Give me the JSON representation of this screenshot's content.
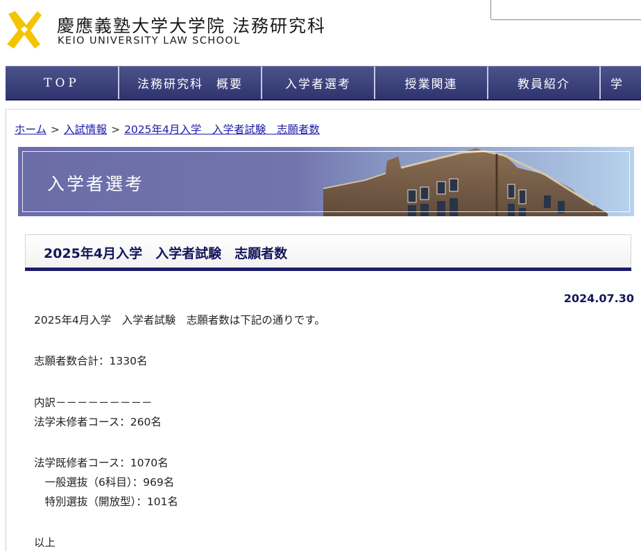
{
  "header": {
    "title": "慶應義塾大学大学院 法務研究科",
    "subtitle": "KEIO UNIVERSITY LAW SCHOOL",
    "search_placeholder": ""
  },
  "nav": {
    "items": [
      {
        "label": "TOP"
      },
      {
        "label": "法務研究科　概要"
      },
      {
        "label": "入学者選考"
      },
      {
        "label": "授業関連"
      },
      {
        "label": "教員紹介"
      },
      {
        "label": "学"
      }
    ]
  },
  "breadcrumb": {
    "home": "ホーム",
    "section": "入試情報",
    "current": "2025年4月入学　入学者試験　志願者数",
    "separator": ">"
  },
  "banner": {
    "title": "入学者選考"
  },
  "article": {
    "heading": "2025年4月入学　入学者試験　志願者数",
    "date": "2024.07.30",
    "intro": "2025年4月入学　入学者試験　志願者数は下記の通りです。",
    "total": "志願者数合計：1330名",
    "breakdown_header": "内訳－－－－－－－－－",
    "mishusha": "法学未修者コース：260名",
    "kishusha": "法学既修者コース：1070名",
    "general": "　一般選抜（6科目）：969名",
    "special": "　特別選抜（開放型）：101名",
    "closing": "以上"
  },
  "colors": {
    "nav_bg": "#3b3f7b",
    "heading_text": "#15155a",
    "link": "#1a1aa6",
    "logo": "#f5c400"
  }
}
